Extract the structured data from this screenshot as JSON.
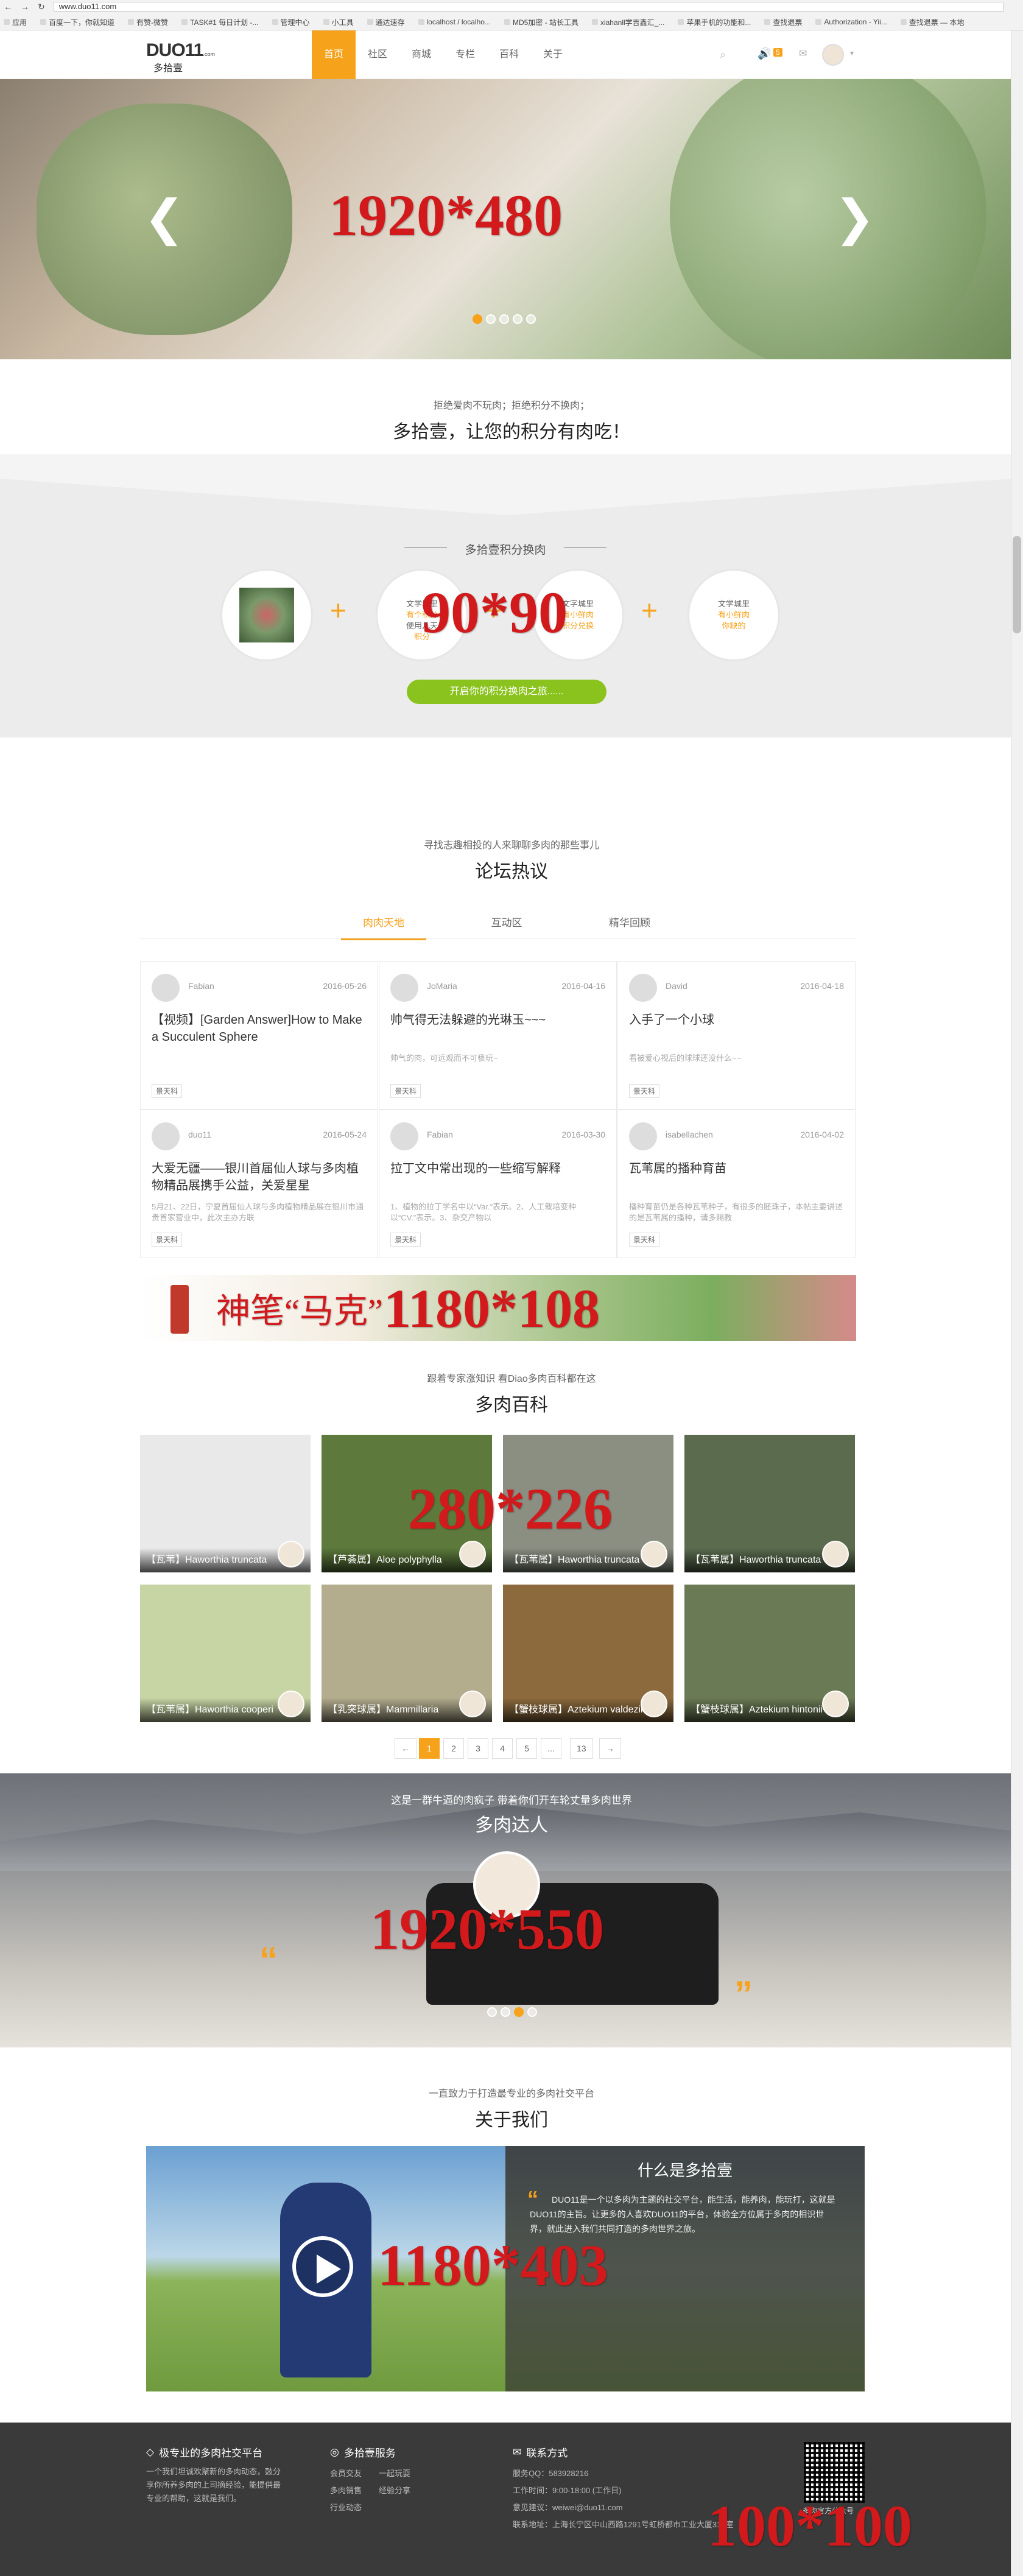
{
  "browser": {
    "url": "www.duo11.com",
    "bookmarks": [
      "应用",
      "百度一下，你就知道",
      "有赞-微赞",
      "TASK#1 每日计划 -...",
      "管理中心",
      "小工具",
      "通达速存",
      "localhost / localho...",
      "MD5加密 - 站长工具",
      "xiahanll学吉鑫汇_...",
      "苹果手机的功能和...",
      "查找退票",
      "Authorization - Yii...",
      "查找退票 — 本地"
    ]
  },
  "nav": {
    "logo_main": "DUO11",
    "logo_suffix": ".com",
    "logo_sub": "多拾壹",
    "items": [
      "首页",
      "社区",
      "商城",
      "专栏",
      "百科",
      "关于"
    ],
    "active_index": 0,
    "notice_count": "5",
    "accent": "#f7a21b"
  },
  "hero1": {
    "label": "1920*480",
    "prev": "❮",
    "next": "❯",
    "dots": 5,
    "active_dot": 0
  },
  "slogan": {
    "sub": "拒绝爱肉不玩肉；拒绝积分不换肉；",
    "title": "多拾壹，让您的积分有肉吃！"
  },
  "exchange": {
    "title": "多拾壹积分换肉",
    "label": "90*90",
    "circles": [
      {
        "lines": []
      },
      {
        "lines": [
          "文学城里",
          "有个积分",
          "使用几天",
          "积分"
        ]
      },
      {
        "lines": [
          "文字城里",
          "有小鲜肉",
          "积分兑换"
        ]
      },
      {
        "lines": [
          "文学城里",
          "有小鲜肉",
          "你缺的"
        ]
      }
    ],
    "plus": "+",
    "button": "开启你的积分换肉之旅......"
  },
  "forum": {
    "sub": "寻找志趣相投的人来聊聊多肉的那些事儿",
    "title": "论坛热议",
    "tabs": [
      "肉肉天地",
      "互动区",
      "精华回顾"
    ],
    "active_tab": 0,
    "posts": [
      {
        "author": "Fabian",
        "date": "2016-05-26",
        "title": "【视频】[Garden Answer]How to Make a Succulent Sphere",
        "excerpt": "",
        "tag": "景天科"
      },
      {
        "author": "JoMaria",
        "date": "2016-04-16",
        "title": "帅气得无法躲避的光琳玉~~~",
        "excerpt": "帅气的肉，可远观而不可亵玩~",
        "tag": "景天科"
      },
      {
        "author": "David",
        "date": "2016-04-18",
        "title": "入手了一个小球",
        "excerpt": "看被爱心视后的球球还没什么~~",
        "tag": "景天科"
      },
      {
        "author": "duo11",
        "date": "2016-05-24",
        "title": "大爱无疆——银川首届仙人球与多肉植物精品展携手公益，关爱星星",
        "excerpt": "5月21、22日，宁夏首届仙人球与多肉植物精品展在银川市通贵首家营业中，此次主办方联",
        "tag": "景天科"
      },
      {
        "author": "Fabian",
        "date": "2016-03-30",
        "title": "拉丁文中常出现的一些缩写解释",
        "excerpt": "1、植物的拉丁学名中以“Var.”表示。2、人工栽培变种以“CV.”表示。3、杂交产物以",
        "tag": "景天科"
      },
      {
        "author": "isabellachen",
        "date": "2016-04-02",
        "title": "瓦苇属的播种育苗",
        "excerpt": "播种育苗仍是各种瓦苇种子，有很多的胚珠子，本帖主要讲述的是瓦苇属的播种，请多赐教",
        "tag": "景天科"
      }
    ]
  },
  "ad_banner": {
    "text": "神笔“马克”",
    "label": "1180*108"
  },
  "wiki": {
    "sub": "跟着专家涨知识 看Diao多肉百科都在这",
    "title": "多肉百科",
    "label": "280*226",
    "items": [
      "【瓦苇】Haworthia truncata",
      "【芦荟属】Aloe polyphylla",
      "【瓦苇属】Haworthia truncata",
      "【瓦苇属】Haworthia truncata",
      "【瓦苇属】Haworthia cooperi",
      "【乳突球属】Mammillaria",
      "【蟹枝球属】Aztekium valdezii",
      "【蟹枝球属】Aztekium hintonii"
    ],
    "pagination": [
      "←",
      "1",
      "2",
      "3",
      "4",
      "5",
      "...",
      "13",
      "→"
    ],
    "active_page": "1"
  },
  "masters": {
    "sub": "这是一群牛逼的肉疯子 带着你们开车轮丈量多肉世界",
    "title": "多肉达人",
    "label": "1920*550",
    "quote_open": "“",
    "quote_close": "”",
    "dots": 4,
    "active_dot": 2
  },
  "about": {
    "sub": "一直致力于打造最专业的多肉社交平台",
    "title": "关于我们",
    "label": "1180*403",
    "panel_title": "什么是多拾壹",
    "panel_text": "DUO11是一个以多肉为主题的社交平台，能生活，能养肉，能玩打，这就是DUO11的主旨。让更多的人喜欢DUO11的平台，体验全方位属于多肉的相识世界，就此进入我们共同打造的多肉世界之旅。",
    "quote": "“"
  },
  "footer": {
    "col1_title": "极专业的多肉社交平台",
    "col1_text": [
      "一个我们坦诚欢聚新的多肉动态，鼓分",
      "享你所养多肉的上司摘经验，能提供最",
      "专业的帮助，这就是我们。"
    ],
    "col2_title": "多拾壹服务",
    "col2_links": [
      "会员交友",
      "多肉销售",
      "行业动态",
      "一起玩耍",
      "经验分享"
    ],
    "col3_title": "联系方式",
    "col3_lines": [
      "服务QQ：583928216",
      "工作时间：9:00-18:00 (工作日)",
      "意见建议：weiwei@duo11.com",
      "联系地址：上海长宁区中山西路1291号虹桥都市工业大厦315室"
    ],
    "qr_caption": "多肉官方公众号",
    "qr_label": "100*100"
  }
}
